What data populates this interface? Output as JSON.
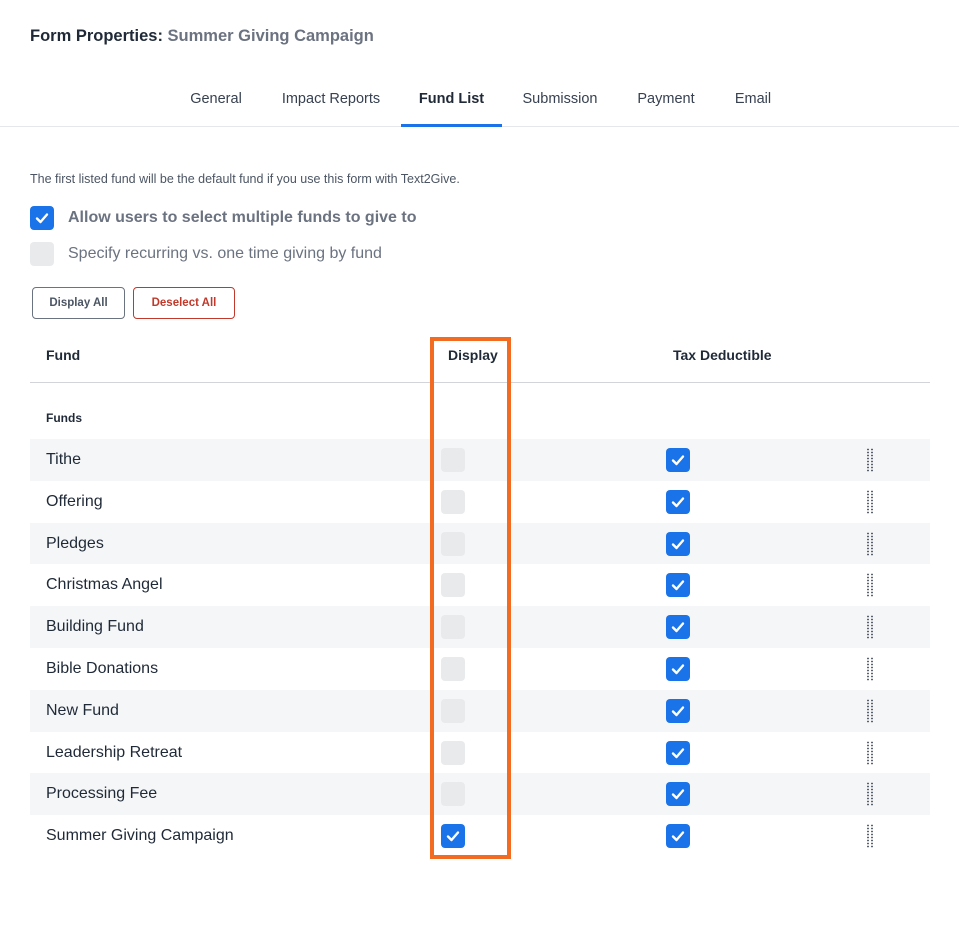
{
  "header": {
    "title_prefix": "Form Properties:",
    "form_name": "Summer Giving Campaign"
  },
  "tabs": [
    {
      "label": "General",
      "active": false
    },
    {
      "label": "Impact Reports",
      "active": false
    },
    {
      "label": "Fund List",
      "active": true
    },
    {
      "label": "Submission",
      "active": false
    },
    {
      "label": "Payment",
      "active": false
    },
    {
      "label": "Email",
      "active": false
    }
  ],
  "fund_list": {
    "note": "The first listed fund will be the default fund if you use this form with Text2Give.",
    "options": [
      {
        "label": "Allow users to select multiple funds to give to",
        "checked": true
      },
      {
        "label": "Specify recurring vs. one time giving by fund",
        "checked": false
      }
    ],
    "buttons": {
      "display_all": "Display All",
      "deselect_all": "Deselect All"
    },
    "table": {
      "headers": {
        "fund": "Fund",
        "display": "Display",
        "tax_deductible": "Tax Deductible"
      },
      "group_label": "Funds",
      "rows": [
        {
          "name": "Tithe",
          "display": false,
          "tax_deductible": true
        },
        {
          "name": "Offering",
          "display": false,
          "tax_deductible": true
        },
        {
          "name": "Pledges",
          "display": false,
          "tax_deductible": true
        },
        {
          "name": "Christmas Angel",
          "display": false,
          "tax_deductible": true
        },
        {
          "name": "Building Fund",
          "display": false,
          "tax_deductible": true
        },
        {
          "name": "Bible Donations",
          "display": false,
          "tax_deductible": true
        },
        {
          "name": "New Fund",
          "display": false,
          "tax_deductible": true
        },
        {
          "name": "Leadership Retreat",
          "display": false,
          "tax_deductible": true
        },
        {
          "name": "Processing Fee",
          "display": false,
          "tax_deductible": true
        },
        {
          "name": "Summer Giving Campaign",
          "display": true,
          "tax_deductible": true
        }
      ]
    }
  },
  "colors": {
    "accent": "#1a73e8",
    "highlight": "#f26b21",
    "danger": "#c0392b",
    "unchecked": "#e9eaec",
    "row_stripe": "#f5f6f7"
  }
}
